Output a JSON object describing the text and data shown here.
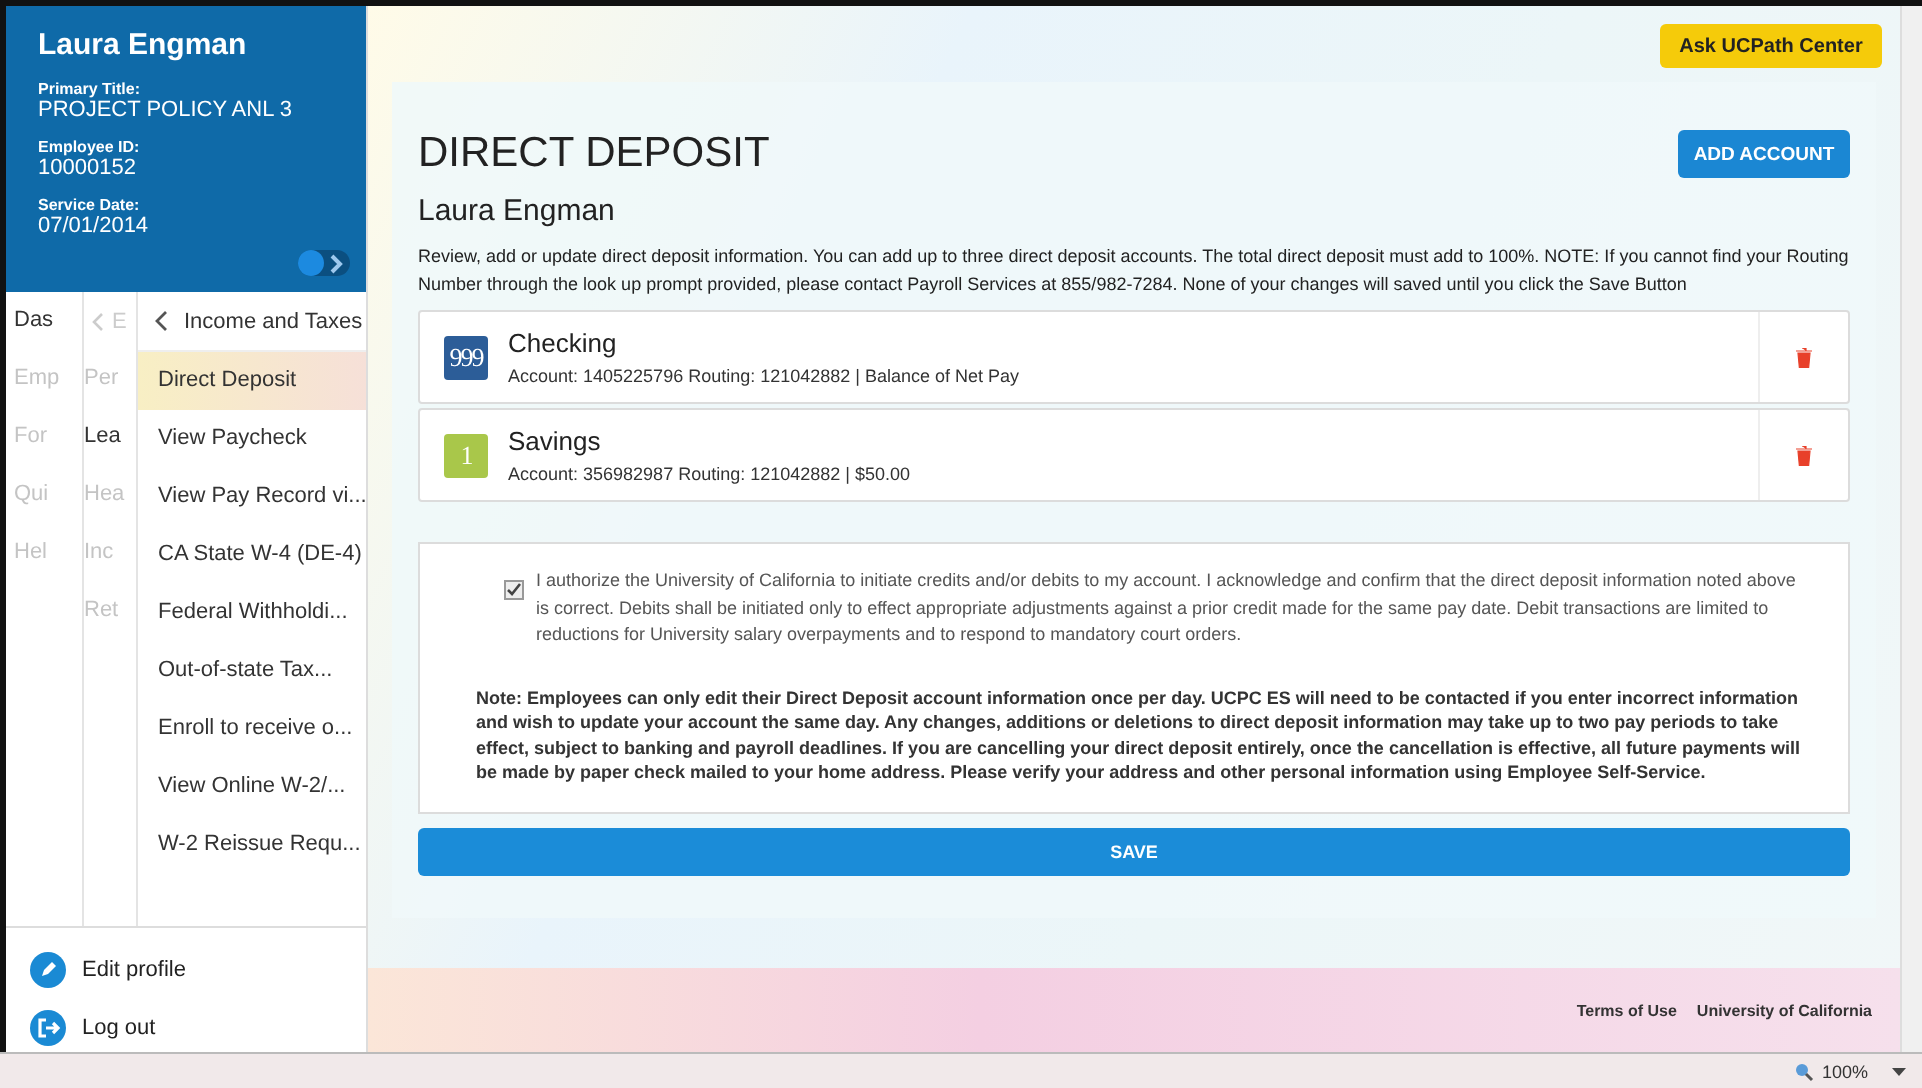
{
  "profile": {
    "name": "Laura Engman",
    "fields": [
      {
        "label": "Primary Title:",
        "value": "PROJECT POLICY ANL 3"
      },
      {
        "label": "Employee ID:",
        "value": "10000152"
      },
      {
        "label": "Service Date:",
        "value": "07/01/2014"
      }
    ],
    "panel_toggle": {
      "on": false
    }
  },
  "nav": {
    "column_1": [
      {
        "label": "Das",
        "dimmed": false
      },
      {
        "label": "Emp",
        "dimmed": true
      },
      {
        "label": "For",
        "dimmed": true
      },
      {
        "label": "Qui",
        "dimmed": true
      },
      {
        "label": "Hel",
        "dimmed": true
      }
    ],
    "column_2_back": "E",
    "column_2": [
      {
        "label": "Per",
        "dimmed": true
      },
      {
        "label": "Lea",
        "dimmed": false
      },
      {
        "label": "Hea",
        "dimmed": true
      },
      {
        "label": "Inc",
        "dimmed": true
      },
      {
        "label": "Ret",
        "dimmed": true
      }
    ],
    "menu_title": "Income and Taxes",
    "menu": [
      {
        "label": "Direct Deposit",
        "selected": true
      },
      {
        "label": "View Paycheck",
        "selected": false
      },
      {
        "label": "View Pay Record vi...",
        "selected": false
      },
      {
        "label": "CA State W-4 (DE-4)",
        "selected": false
      },
      {
        "label": "Federal Withholdi...",
        "selected": false
      },
      {
        "label": "Out-of-state Tax...",
        "selected": false
      },
      {
        "label": "Enroll to receive o...",
        "selected": false
      },
      {
        "label": "View Online W-2/...",
        "selected": false
      },
      {
        "label": "W-2 Reissue Requ...",
        "selected": false
      }
    ]
  },
  "sidebar_actions": [
    {
      "label": "Edit profile",
      "kind": "edit"
    },
    {
      "label": "Log out",
      "kind": "logout"
    }
  ],
  "help_button": "Ask UCPath Center",
  "page": {
    "title": "DIRECT DEPOSIT",
    "add_button": "ADD ACCOUNT",
    "subtitle": "Laura Engman",
    "description": "Review, add or update direct deposit information. You can add up to three direct deposit accounts. The total direct deposit must add to 100%. NOTE: If you cannot find your Routing Number through the look up prompt provided, please contact Payroll Services at 855/982-7284. None of your changes will saved until you click the Save Button",
    "accounts": [
      {
        "badge": "999",
        "color": "#2c5d98",
        "type": "Checking",
        "details": "Account: 1405225796 Routing: 121042882 | Balance of Net Pay"
      },
      {
        "badge": "1",
        "color": "#a9c74a",
        "type": "Savings",
        "details": "Account: 356982987 Routing: 121042882 | $50.00"
      }
    ],
    "authorization": {
      "checked": true,
      "text": "I authorize the University of California to initiate credits and/or debits to my account. I acknowledge and confirm that the direct deposit information noted above is correct. Debits shall be initiated only to effect appropriate adjustments against a prior credit made for the same pay date. Debit transactions are limited to reductions for University salary overpayments and to respond to mandatory court orders."
    },
    "note": "Note: Employees can only edit their Direct Deposit account information once per day. UCPC ES will need to be contacted if you enter incorrect information and wish to update your account the same day. Any changes, additions or deletions to direct deposit information may take up to two pay periods to take effect, subject to banking and payroll deadlines. If you are cancelling your direct deposit entirely, once the cancellation is effective, all future payments will be made by paper check mailed to your home address. Please verify your address and other personal information using Employee Self-Service.",
    "save_button": "SAVE"
  },
  "footer_links": [
    "Terms of Use",
    "University of California"
  ],
  "status_bar": {
    "zoom": "100%"
  }
}
